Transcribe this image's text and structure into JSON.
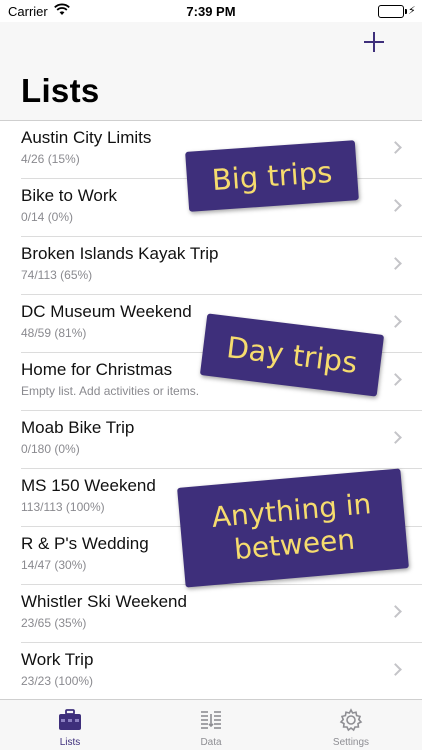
{
  "status_bar": {
    "carrier": "Carrier",
    "time": "7:39 PM"
  },
  "nav": {
    "title": "Lists",
    "add_icon": "plus-icon"
  },
  "lists": [
    {
      "title": "Austin City Limits",
      "subtitle": "4/26  (15%)"
    },
    {
      "title": "Bike to Work",
      "subtitle": "0/14  (0%)"
    },
    {
      "title": "Broken Islands Kayak Trip",
      "subtitle": "74/113  (65%)"
    },
    {
      "title": "DC Museum Weekend",
      "subtitle": "48/59  (81%)"
    },
    {
      "title": "Home for Christmas",
      "subtitle": "Empty list. Add activities or items."
    },
    {
      "title": "Moab Bike Trip",
      "subtitle": "0/180  (0%)"
    },
    {
      "title": "MS 150 Weekend",
      "subtitle": "113/113  (100%)"
    },
    {
      "title": "R & P's Wedding",
      "subtitle": "14/47  (30%)"
    },
    {
      "title": "Whistler Ski Weekend",
      "subtitle": "23/65  (35%)"
    },
    {
      "title": "Work Trip",
      "subtitle": "23/23  (100%)"
    }
  ],
  "callouts": {
    "big_trips": "Big trips",
    "day_trips": "Day trips",
    "anything_line1": "Anything in",
    "anything_line2": "between"
  },
  "tabs": [
    {
      "label": "Lists",
      "icon": "briefcase-icon",
      "active": true
    },
    {
      "label": "Data",
      "icon": "data-sort-icon",
      "active": false
    },
    {
      "label": "Settings",
      "icon": "gear-icon",
      "active": false
    }
  ],
  "colors": {
    "accent": "#3e2f7b",
    "callout_text": "#f6dc6e",
    "battery": "#4cd964"
  }
}
